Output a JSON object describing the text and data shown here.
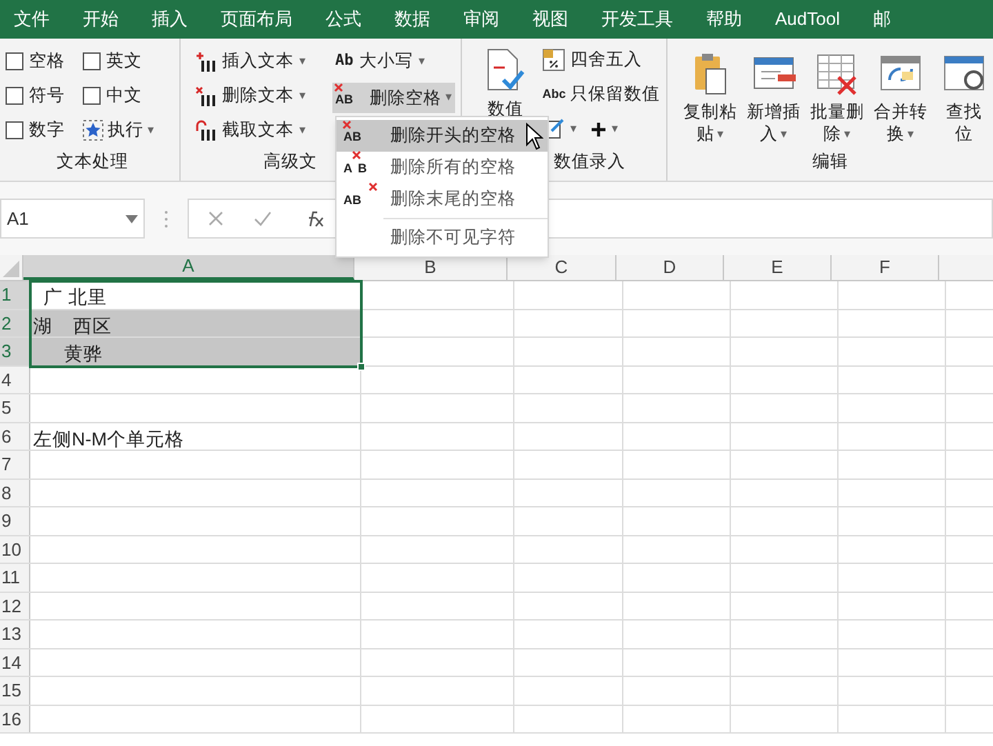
{
  "tabs": [
    {
      "label": "文件",
      "selected": false
    },
    {
      "label": "开始",
      "selected": false
    },
    {
      "label": "插入",
      "selected": false
    },
    {
      "label": "页面布局",
      "selected": false
    },
    {
      "label": "公式",
      "selected": false
    },
    {
      "label": "数据",
      "selected": false
    },
    {
      "label": "审阅",
      "selected": false
    },
    {
      "label": "视图",
      "selected": false
    },
    {
      "label": "开发工具",
      "selected": false
    },
    {
      "label": "帮助",
      "selected": false
    },
    {
      "label": "AudTool",
      "selected": false
    },
    {
      "label": "邮",
      "selected": false
    }
  ],
  "ribbon": {
    "text_group": {
      "checkboxes": [
        {
          "label": "空格",
          "checked": false
        },
        {
          "label": "英文",
          "checked": false
        },
        {
          "label": "符号",
          "checked": false
        },
        {
          "label": "中文",
          "checked": false
        },
        {
          "label": "数字",
          "checked": false
        }
      ],
      "run_button": "执行",
      "caret": "▾",
      "label": "文本处理"
    },
    "advanced_group": {
      "buttons": [
        {
          "kind": "insert",
          "label": "插入文本",
          "caret": "▾",
          "expanded": false
        },
        {
          "kind": "delete",
          "label": "删除文本",
          "caret": "▾",
          "expanded": false
        },
        {
          "kind": "extract",
          "label": "截取文本",
          "caret": "▾",
          "expanded": false
        }
      ],
      "case_button": {
        "icon_text": "Ab",
        "label": "大小写",
        "caret": "▾"
      },
      "space_button": {
        "icon_text": "AB",
        "label": "删除空格",
        "caret": "▾",
        "expanded": true
      },
      "label": "高级文"
    },
    "number_group": {
      "big_button": "数值",
      "round_button": "四舍五入",
      "keep_button": {
        "icon_text": "Abc",
        "label": "只保留数值"
      },
      "small_carets": [
        "▾",
        "▾"
      ],
      "label": "数值录入"
    },
    "edit_group": {
      "buttons": [
        {
          "kind": "paste",
          "lines": [
            "复制粘",
            "贴"
          ],
          "caret": "▾"
        },
        {
          "kind": "insert-row",
          "lines": [
            "新增插",
            "入"
          ],
          "caret": "▾"
        },
        {
          "kind": "delete-grid",
          "lines": [
            "批量删",
            "除"
          ],
          "caret": "▾"
        },
        {
          "kind": "merge",
          "lines": [
            "合并转",
            "换"
          ],
          "caret": "▾"
        },
        {
          "kind": "find",
          "lines": [
            "查找",
            "位"
          ]
        }
      ],
      "label": "编辑"
    }
  },
  "name_box": {
    "value": "A1"
  },
  "dropdown": {
    "items": [
      {
        "kind": "x-left",
        "icon_text": "AB",
        "label": "删除开头的空格",
        "selected": true
      },
      {
        "kind": "x-middle",
        "icon_text": "AB",
        "label": "删除所有的空格",
        "selected": false
      },
      {
        "kind": "x-right",
        "icon_text": "AB",
        "label": "删除末尾的空格",
        "selected": false
      },
      {
        "kind": "none",
        "label": "删除不可见字符",
        "selected": false
      }
    ]
  },
  "sheet": {
    "columns": [
      {
        "label": "A",
        "selected": true
      },
      {
        "label": "B",
        "selected": false
      },
      {
        "label": "C",
        "selected": false
      },
      {
        "label": "D",
        "selected": false
      },
      {
        "label": "E",
        "selected": false
      },
      {
        "label": "F",
        "selected": false
      }
    ],
    "rows": [
      {
        "header": "1",
        "selected": true,
        "cell": {
          "text": "  广 北里",
          "shaded": false
        }
      },
      {
        "header": "2",
        "selected": true,
        "cell": {
          "text": "湖    西区",
          "shaded": true
        }
      },
      {
        "header": "3",
        "selected": true,
        "cell": {
          "text": "      黄骅",
          "shaded": true
        }
      },
      {
        "header": "4",
        "selected": false
      },
      {
        "header": "5",
        "selected": false
      },
      {
        "header": "6",
        "selected": false,
        "cell": {
          "text": "左侧N-M个单元格",
          "shaded": false
        }
      },
      {
        "header": "7",
        "selected": false
      },
      {
        "header": "8",
        "selected": false
      },
      {
        "header": "9",
        "selected": false
      },
      {
        "header": "10",
        "selected": false
      },
      {
        "header": "11",
        "selected": false
      },
      {
        "header": "12",
        "selected": false
      },
      {
        "header": "13",
        "selected": false
      },
      {
        "header": "14",
        "selected": false
      },
      {
        "header": "15",
        "selected": false
      },
      {
        "header": "16",
        "selected": false
      }
    ]
  }
}
